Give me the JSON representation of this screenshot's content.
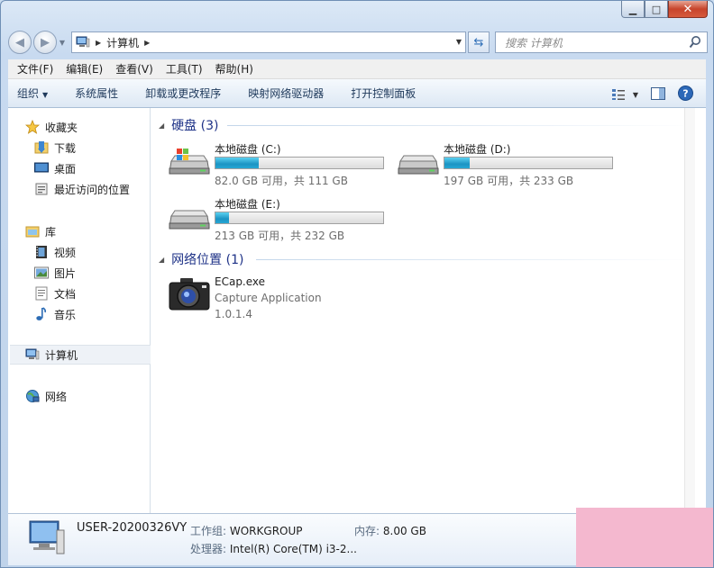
{
  "nav": {
    "address_path": "计算机",
    "search_placeholder": "搜索 计算机"
  },
  "menu": [
    "文件(F)",
    "编辑(E)",
    "查看(V)",
    "工具(T)",
    "帮助(H)"
  ],
  "commands": [
    "组织",
    "系统属性",
    "卸载或更改程序",
    "映射网络驱动器",
    "打开控制面板"
  ],
  "sidebar": {
    "favorites": {
      "label": "收藏夹",
      "items": [
        "下载",
        "桌面",
        "最近访问的位置"
      ]
    },
    "libraries": {
      "label": "库",
      "items": [
        "视频",
        "图片",
        "文档",
        "音乐"
      ]
    },
    "computer": "计算机",
    "network": "网络"
  },
  "groups": {
    "drives_header": "硬盘 (3)",
    "network_header": "网络位置 (1)"
  },
  "drives": [
    {
      "name": "本地磁盘 (C:)",
      "free": "82.0 GB 可用，共 111 GB",
      "used_fraction": 0.26
    },
    {
      "name": "本地磁盘 (D:)",
      "free": "197 GB 可用，共 233 GB",
      "used_fraction": 0.15
    },
    {
      "name": "本地磁盘 (E:)",
      "free": "213 GB 可用，共 232 GB",
      "used_fraction": 0.08
    }
  ],
  "network_item": {
    "name": "ECap.exe",
    "description": "Capture Application",
    "version": "1.0.1.4"
  },
  "details": {
    "computer_name": "USER-20200326VY",
    "workgroup_label": "工作组:",
    "workgroup_value": "WORKGROUP",
    "memory_label": "内存:",
    "memory_value": "8.00 GB",
    "processor_label": "处理器:",
    "processor_value": "Intel(R) Core(TM) i3-2..."
  },
  "colors": {
    "accent": "#1e3287",
    "drive_fill": "#26a7d4",
    "overlay": "#f4b8cf"
  }
}
